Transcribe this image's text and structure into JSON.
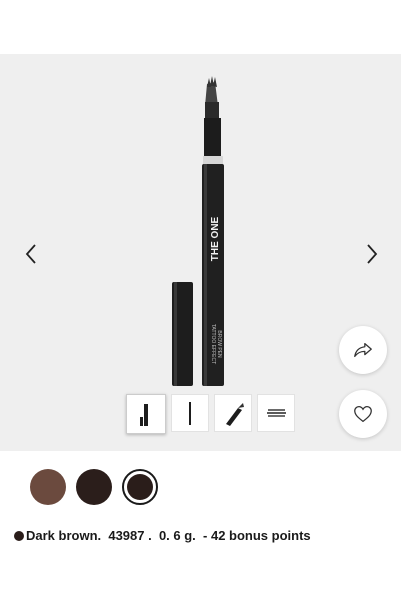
{
  "product": {
    "brand_on_pen": "THE ONE",
    "pen_label_line1": "TATTOO EFFECT",
    "pen_label_line2": "BROW PEN"
  },
  "gallery": {
    "icons": {
      "prev": "chevron-left-icon",
      "next": "chevron-right-icon",
      "share": "share-arrow-icon",
      "favorite": "heart-icon"
    },
    "thumbnails": [
      {
        "name": "pen-cap-view",
        "active": true
      },
      {
        "name": "pen-side-view",
        "active": false
      },
      {
        "name": "pen-tip-view",
        "active": false
      },
      {
        "name": "brow-stroke-swatch",
        "active": false
      }
    ]
  },
  "shades": [
    {
      "name": "Light brown",
      "color": "#6b4a3e"
    },
    {
      "name": "Dark brown",
      "color": "#2b1e1b"
    },
    {
      "name": "Dark brown selected",
      "color": "#2a1d1a",
      "selected": true
    }
  ],
  "selection": {
    "dot_color": "#2a1d1a",
    "text": "Dark brown.  43987 .  0. 6 g.  - 42 bonus points"
  }
}
